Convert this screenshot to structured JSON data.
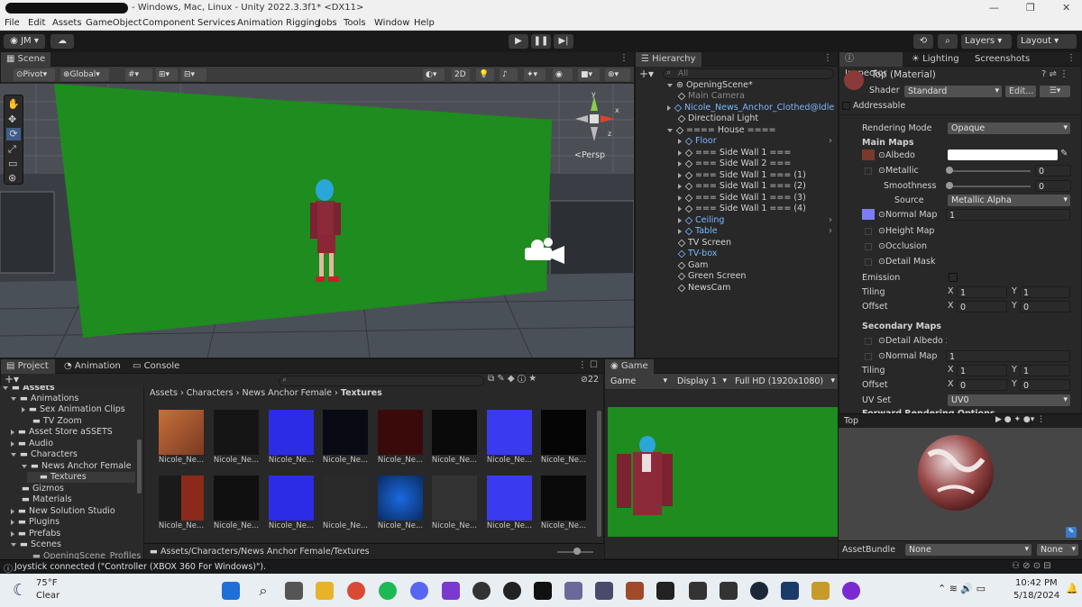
{
  "window": {
    "title": "- Windows, Mac, Linux - Unity 2022.3.3f1* <DX11>"
  },
  "menu": [
    "File",
    "Edit",
    "Assets",
    "GameObject",
    "Component",
    "Services",
    "Animation Rigging",
    "Jobs",
    "Tools",
    "Window",
    "Help"
  ],
  "toolbar": {
    "account": "JM",
    "layers": "Layers",
    "layout": "Layout"
  },
  "scene": {
    "tab": "Scene",
    "pivot": "Pivot",
    "global": "Global",
    "mode_2d": "2D",
    "persp": "Persp",
    "gizmo_axes": {
      "y": "y",
      "x": "x",
      "z": "z"
    }
  },
  "hierarchy": {
    "tab": "Hierarchy",
    "search_placeholder": "All",
    "scene": "OpeningScene*",
    "items": [
      "Main Camera",
      "Nicole_News_Anchor_Clothed@Idle",
      "Directional Light",
      "==== House ====",
      "Floor",
      "=== Side Wall 1 ===",
      "=== Side Wall 2 ===",
      "=== Side Wall 1 === (1)",
      "=== Side Wall 1 === (2)",
      "=== Side Wall 1 === (3)",
      "=== Side Wall 1 === (4)",
      "Ceiling",
      "Table",
      "TV Screen",
      "TV-box",
      "Gam",
      "Green Screen",
      "NewsCam"
    ]
  },
  "inspector": {
    "tabs": [
      "Inspector",
      "Lighting",
      "Screenshots"
    ],
    "material_name": "Top (Material)",
    "shader_label": "Shader",
    "shader_value": "Standard",
    "edit_button": "Edit...",
    "addressable": "Addressable",
    "rendering_mode_label": "Rendering Mode",
    "rendering_mode_value": "Opaque",
    "main_maps": "Main Maps",
    "albedo": "Albedo",
    "metallic": "Metallic",
    "metallic_value": "0",
    "smoothness": "Smoothness",
    "smoothness_value": "0",
    "source_label": "Source",
    "source_value": "Metallic Alpha",
    "normal_map": "Normal Map",
    "normal_map_value": "1",
    "height_map": "Height Map",
    "occlusion": "Occlusion",
    "detail_mask": "Detail Mask",
    "emission": "Emission",
    "tiling": "Tiling",
    "offset": "Offset",
    "tiling_x": "1",
    "tiling_y": "1",
    "offset_x": "0",
    "offset_y": "0",
    "x_label": "X",
    "y_label": "Y",
    "secondary_maps": "Secondary Maps",
    "detail_albedo": "Detail Albedo x2",
    "normal_map2": "Normal Map",
    "normal_map2_value": "1",
    "tiling2_x": "1",
    "tiling2_y": "1",
    "offset2_x": "0",
    "offset2_y": "0",
    "uv_set_label": "UV Set",
    "uv_set_value": "UV0",
    "forward_rendering": "Forward Rendering Options",
    "preview_title": "Top",
    "assetbundle_label": "AssetBundle",
    "assetbundle_value": "None",
    "assetbundle_variant": "None",
    "colors": {
      "albedo_swatch": "#ffffff",
      "normal_swatch": "#7d7df5"
    }
  },
  "project": {
    "tabs": [
      "Project",
      "Animation",
      "Console"
    ],
    "tree": [
      "Assets",
      "Animations",
      "Sex Animation Clips",
      "TV Zoom",
      "Asset Store aSSETS",
      "Audio",
      "Characters",
      "News Anchor Female",
      "Textures",
      "Gizmos",
      "Materials",
      "New Solution Studio",
      "Plugins",
      "Prefabs",
      "Scenes",
      "OpeningScene_Profiles"
    ],
    "breadcrumb": [
      "Assets",
      "Characters",
      "News Anchor Female",
      "Textures"
    ],
    "item_count": "22",
    "thumb_label": "Nicole_Ne...",
    "footer_path": "Assets/Characters/News Anchor Female/Textures"
  },
  "game": {
    "tab": "Game",
    "mode": "Game",
    "display": "Display 1",
    "resolution": "Full HD (1920x1080)"
  },
  "status": {
    "message": "Joystick connected (\"Controller (XBOX 360 For Windows)\")."
  },
  "taskbar": {
    "weather_temp": "75°F",
    "weather_desc": "Clear",
    "time": "10:42 PM",
    "date": "5/18/2024"
  }
}
